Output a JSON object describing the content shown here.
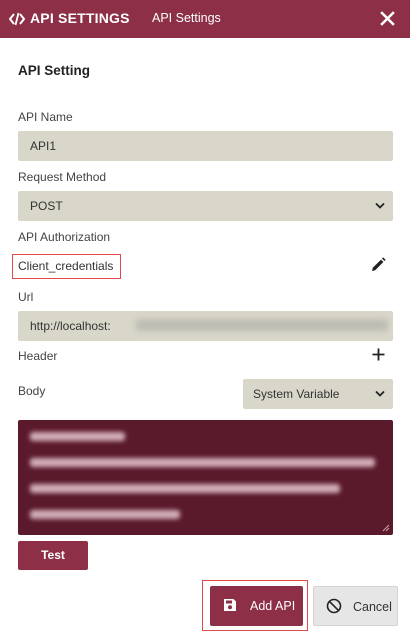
{
  "header": {
    "title": "API SETTINGS",
    "subtitle": "API Settings",
    "icon": "code-icon",
    "close_icon": "close-icon"
  },
  "section_title": "API Setting",
  "api_name": {
    "label": "API Name",
    "value": "API1"
  },
  "request_method": {
    "label": "Request Method",
    "value": "POST"
  },
  "authorization": {
    "label": "API Authorization",
    "value": "Client_credentials",
    "edit_icon": "pencil-icon"
  },
  "url": {
    "label": "Url",
    "value": "http://localhost:"
  },
  "header_row": {
    "label": "Header",
    "add_icon": "plus-icon"
  },
  "body": {
    "label": "Body",
    "variable_select": "System Variable"
  },
  "buttons": {
    "test": "Test",
    "add": "Add API",
    "cancel": "Cancel"
  },
  "colors": {
    "brand": "#8d2f46",
    "field_bg": "#d9d7c9",
    "body_bg": "#5a1a2b",
    "highlight": "#e04a4a"
  }
}
